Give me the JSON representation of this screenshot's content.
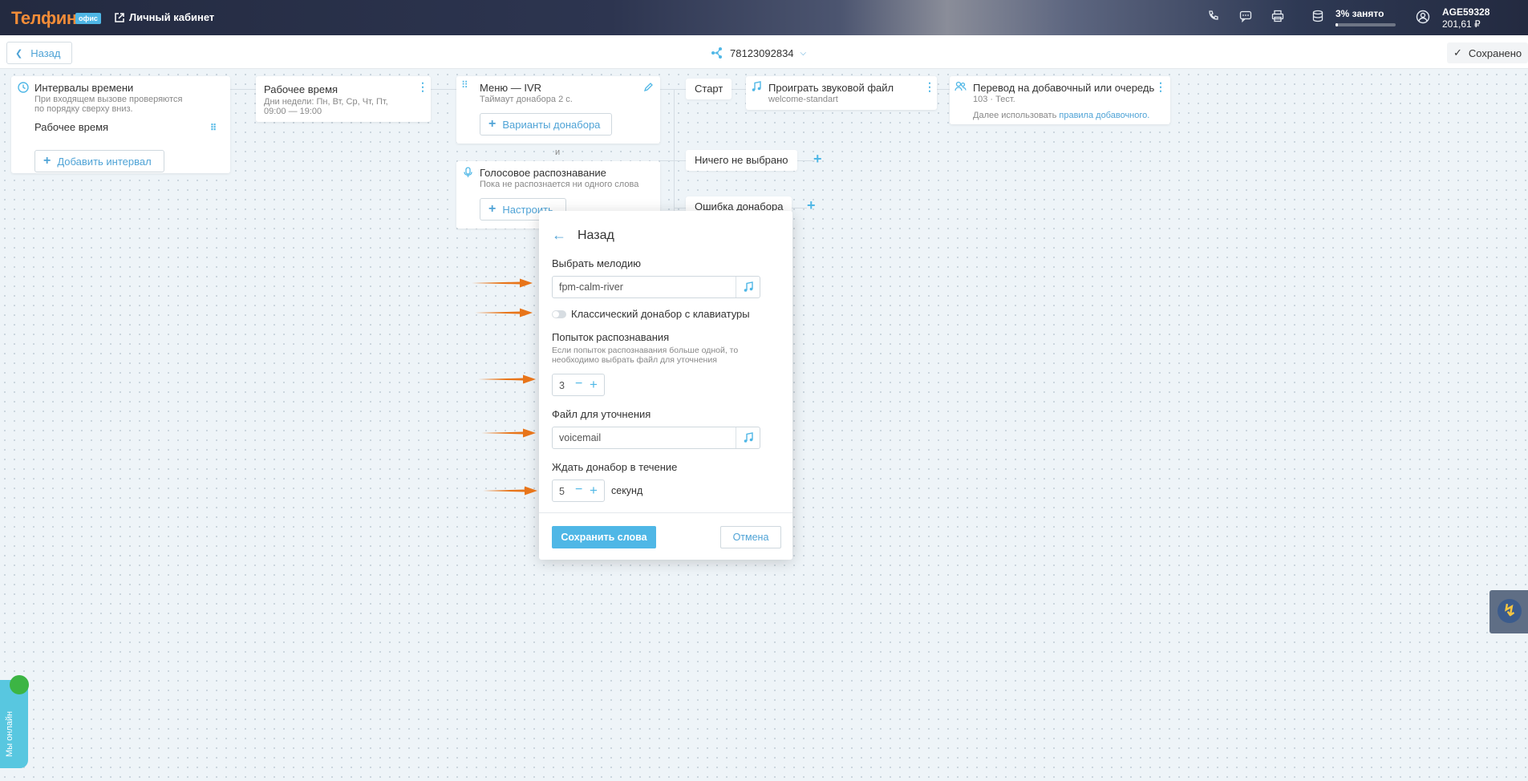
{
  "header": {
    "logo": "Телфин",
    "logo_badge": "офис",
    "cabinet_label": "Личный кабинет",
    "storage_label": "3% занято",
    "storage_fraction": 0.03,
    "account_id": "AGE59328",
    "balance": "201,61 ₽",
    "icons": [
      "phone-icon",
      "chat-icon",
      "fax-icon",
      "database-icon",
      "user-circle-icon"
    ]
  },
  "subbar": {
    "back_label": "Назад",
    "phone_number": "78123092834",
    "saved_label": "Сохранено"
  },
  "nodes": {
    "intervals": {
      "title": "Интервалы времени",
      "subtitle_line1": "При входящем вызове проверяются",
      "subtitle_line2": "по порядку сверху вниз.",
      "item": "Рабочее время",
      "add_button": "Добавить интервал"
    },
    "work_time": {
      "title": "Рабочее время",
      "subtitle_line1": "Дни недели: Пн, Вт, Ср, Чт, Пт,",
      "subtitle_line2": "09:00 — 19:00"
    },
    "ivr": {
      "title": "Меню — IVR",
      "subtitle": "Таймаут донабора 2 с.",
      "button": "Варианты донабора"
    },
    "and_label": "и",
    "voice": {
      "title": "Голосовое распознавание",
      "subtitle": "Пока не распознается ни одного слова",
      "button": "Настроить"
    },
    "start_chip": "Старт",
    "nothing_chip": "Ничего не выбрано",
    "error_chip": "Ошибка донабора",
    "play": {
      "title": "Проиграть звуковой файл",
      "subtitle": "welcome-standart"
    },
    "transfer": {
      "title": "Перевод на добавочный или очередь",
      "subtitle": "103 · Тест.",
      "footer_prefix": "Далее использовать ",
      "footer_link": "правила добавочного."
    }
  },
  "modal": {
    "back_label": "Назад",
    "melody_label": "Выбрать мелодию",
    "melody_value": "fpm-calm-river",
    "classic_toggle_label": "Классический донабор с клавиатуры",
    "classic_toggle_on": false,
    "attempts_label": "Попыток распознавания",
    "attempts_help": "Если попыток распознавания больше одной, то необходимо выбрать файл для уточнения",
    "attempts_value": "3",
    "clarify_label": "Файл для уточнения",
    "clarify_value": "voicemail",
    "wait_label": "Ждать донабор в течение",
    "wait_value": "5",
    "wait_unit": "секунд",
    "save_button": "Сохранить слова",
    "cancel_button": "Отмена"
  },
  "widgets": {
    "online_label": "Мы онлайн"
  },
  "colors": {
    "accent": "#4fb7e6",
    "link": "#4fa3d6",
    "logo": "#f28c38",
    "annotation_arrow": "#e8751a",
    "online_green": "#3cb544"
  }
}
